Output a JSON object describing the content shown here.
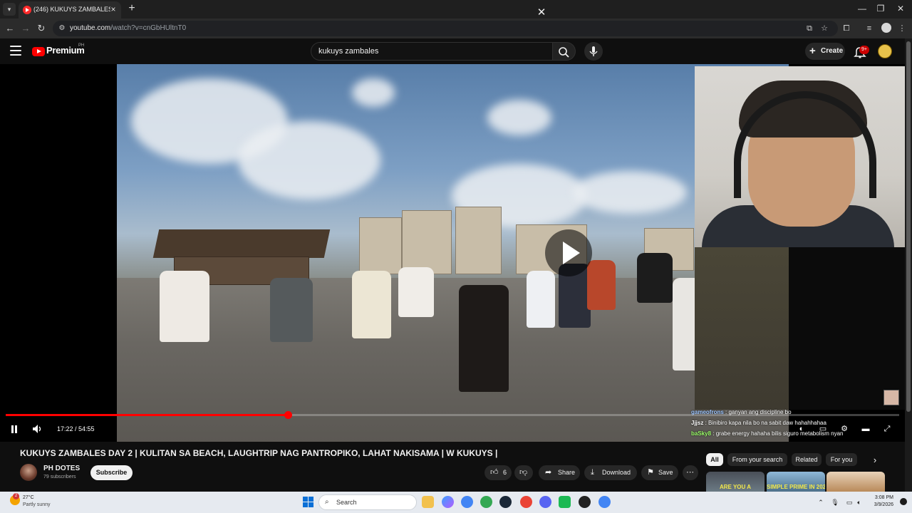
{
  "browser": {
    "tab_title": "(246) KUKUYS ZAMBALES D",
    "url_host": "youtube.com",
    "url_path": "/watch?v=cnGbHUltnT0"
  },
  "youtube": {
    "logo_text": "Premium",
    "logo_country": "PH",
    "search_value": "kukuys zambales",
    "create_label": "Create",
    "notification_count": "9+",
    "brand_color": "#ff0000"
  },
  "player": {
    "current_time": "17:22",
    "duration": "54:55",
    "time_display": "17:22 / 54:55",
    "progress_fraction": 0.316,
    "chat": [
      {
        "user": "gameofrons",
        "message": " : ganyan ang discipline bo",
        "user_color": "#9ec6ff"
      },
      {
        "user": "Jjjsz",
        "message": " : Binibiro kapa nila bo na sabit daw hahahhahaa",
        "user_color": "#ffffff"
      },
      {
        "user": "baSky8",
        "message": " : grabe energy hahaha bilis siguro metabolism nyan",
        "user_color": "#9cff6a"
      }
    ]
  },
  "video": {
    "title": "KUKUYS ZAMBALES DAY 2 | KULITAN SA BEACH, LAUGHTRIP NAG PANTROPIKO, LAHAT NAKISAMA | W KUKUYS |",
    "channel_name": "PH DOTES",
    "subscribers": "79 subscribers",
    "subscribe_label": "Subscribe",
    "like_count": "6",
    "share_label": "Share",
    "download_label": "Download",
    "save_label": "Save"
  },
  "recommendations": {
    "filters": [
      "All",
      "From your search",
      "Related",
      "For you"
    ],
    "thumbnails": [
      {
        "text": "ARE YOU A",
        "color": "#f2e74a"
      },
      {
        "text": "SIMPLE PRIME IN 2025",
        "color": "#f2e74a"
      },
      {
        "text": "",
        "color": "#ffffff"
      }
    ]
  },
  "taskbar": {
    "weather_temp": "27°C",
    "weather_condition": "Partly sunny",
    "weather_badge": "2",
    "search_label": "Search",
    "time": "3:08 PM",
    "date": "3/9/2026"
  }
}
